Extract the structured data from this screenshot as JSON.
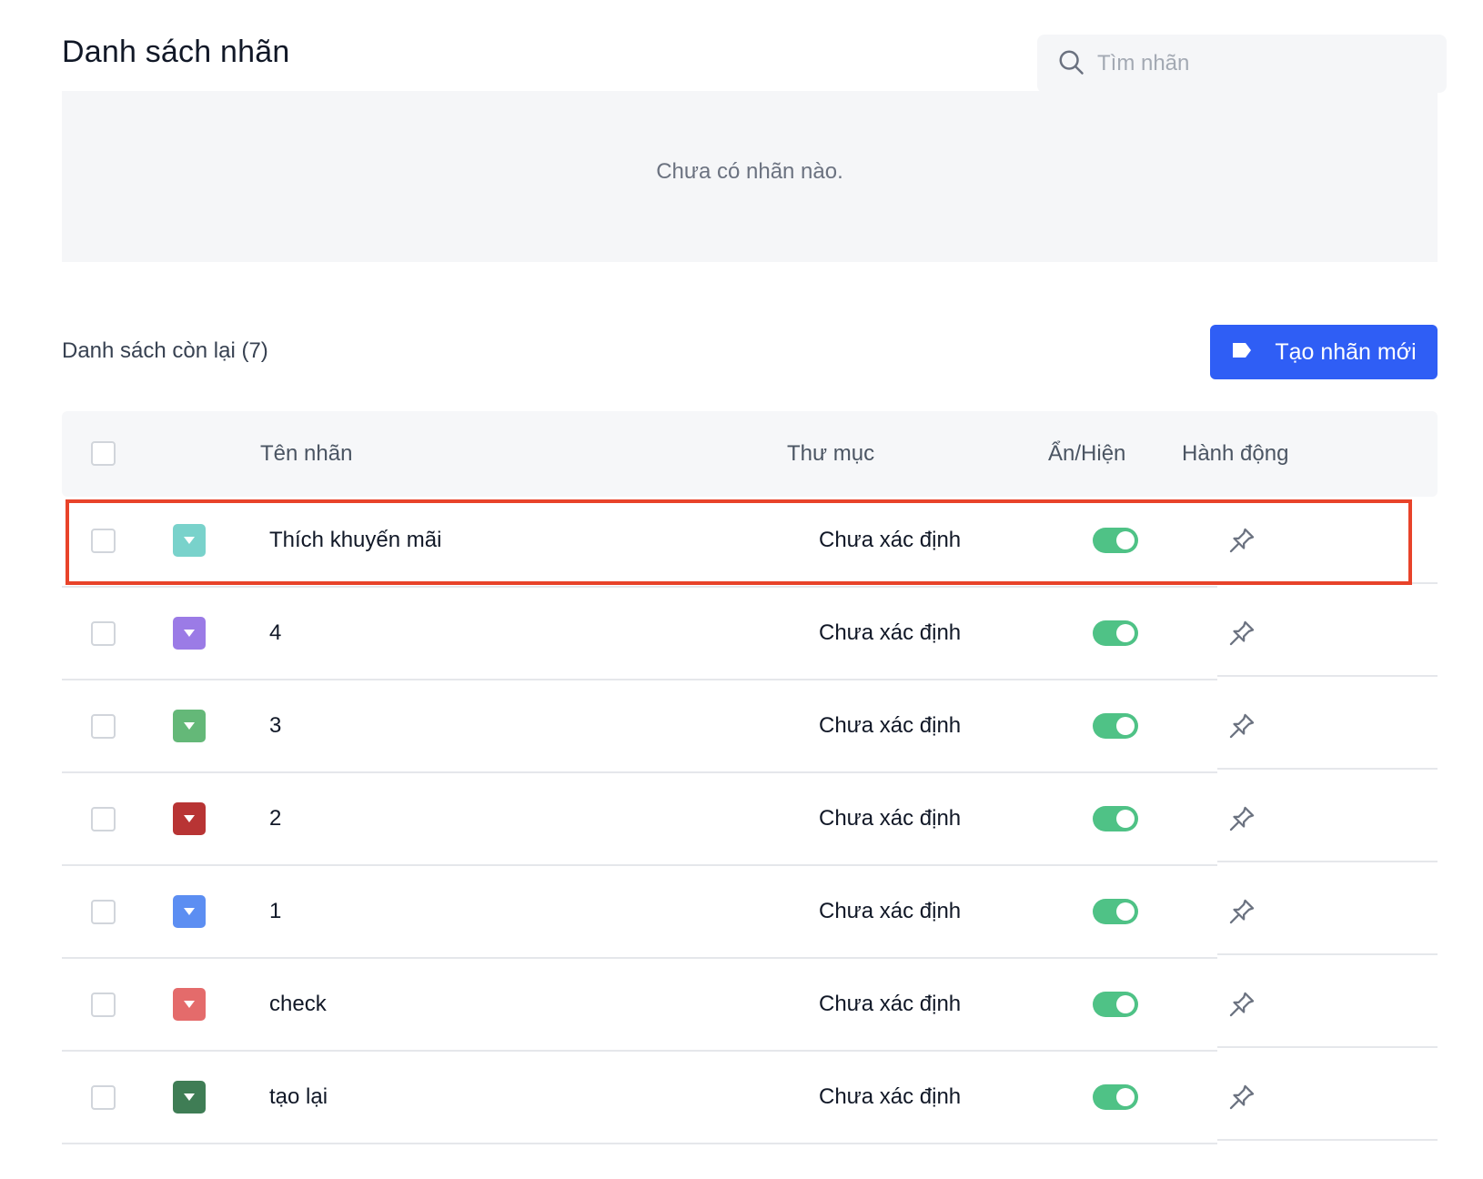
{
  "header": {
    "title": "Danh sách nhãn",
    "search_placeholder": "Tìm nhãn"
  },
  "empty_state": {
    "message": "Chưa có nhãn nào."
  },
  "section": {
    "title": "Danh sách còn lại (7)",
    "create_button_label": "Tạo nhãn mới"
  },
  "table": {
    "columns": {
      "name": "Tên nhãn",
      "folder": "Thư mục",
      "visibility": "Ẩn/Hiện",
      "actions": "Hành động"
    },
    "rows": [
      {
        "name": "Thích khuyến mãi",
        "folder": "Chưa xác định",
        "color": "#79d2cb",
        "visible": true,
        "highlighted": true
      },
      {
        "name": "4",
        "folder": "Chưa xác định",
        "color": "#9b7be6",
        "visible": true
      },
      {
        "name": "3",
        "folder": "Chưa xác định",
        "color": "#64b878",
        "visible": true
      },
      {
        "name": "2",
        "folder": "Chưa xác định",
        "color": "#b83434",
        "visible": true
      },
      {
        "name": "1",
        "folder": "Chưa xác định",
        "color": "#5c8ef2",
        "visible": true
      },
      {
        "name": "check",
        "folder": "Chưa xác định",
        "color": "#e46b6b",
        "visible": true
      },
      {
        "name": "tạo lại",
        "folder": "Chưa xác định",
        "color": "#3f7d55",
        "visible": true
      }
    ]
  },
  "icons": {
    "search": "search-icon",
    "tag": "tag-icon",
    "pin": "pin-icon",
    "dropdown": "caret-down-icon"
  },
  "colors": {
    "primary": "#2f5ef5",
    "toggle_on": "#4fc286",
    "highlight": "#e8432a"
  }
}
